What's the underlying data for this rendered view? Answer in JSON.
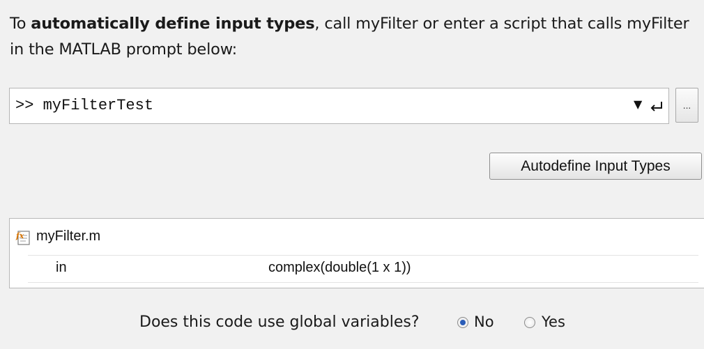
{
  "instruction": {
    "prefix": "To ",
    "bold": "automatically define input types",
    "suffix": ", call myFilter or enter a script that calls myFilter in the MATLAB prompt below:"
  },
  "prompt": {
    "value": ">> myFilterTest",
    "dropdown_icon": "triangle-down-icon",
    "enter_icon": "return-arrow-icon",
    "browse_label": "..."
  },
  "autodefine": {
    "label": "Autodefine Input Types"
  },
  "file_table": {
    "file_icon": "matlab-function-file-icon",
    "file_name": "myFilter.m",
    "params": [
      {
        "name": "in",
        "type": "complex(double(1 x 1))"
      }
    ]
  },
  "globals": {
    "question": "Does this code use global variables?",
    "options": [
      {
        "label": "No",
        "selected": true
      },
      {
        "label": "Yes",
        "selected": false
      }
    ]
  }
}
